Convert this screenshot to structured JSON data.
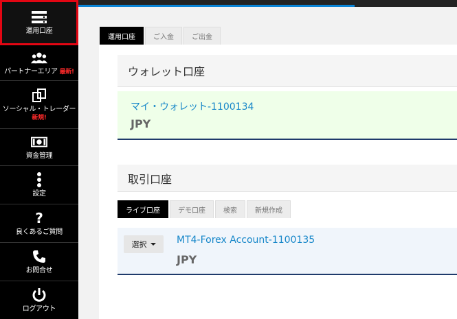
{
  "sidebar": {
    "items": [
      {
        "label": "運用口座",
        "icon": "server-icon",
        "active": true
      },
      {
        "label": "パートナーエリア",
        "badge": "最新!",
        "icon": "users-icon"
      },
      {
        "label": "ソーシャル・トレーダー",
        "badge": "新規!",
        "icon": "copy-icon"
      },
      {
        "label": "資金管理",
        "icon": "money-icon"
      },
      {
        "label": "設定",
        "icon": "dots-vertical-icon"
      },
      {
        "label": "良くあるご質問",
        "icon": "question-icon"
      },
      {
        "label": "お問合せ",
        "icon": "phone-icon"
      },
      {
        "label": "ログアウト",
        "icon": "power-icon"
      }
    ]
  },
  "topbar": {
    "progress_color": "#0a84d6"
  },
  "main_tabs": [
    "運用口座",
    "ご入金",
    "ご出金"
  ],
  "wallet": {
    "title": "ウォレット口座",
    "account_name": "マイ・ウォレット-1100134",
    "currency": "JPY"
  },
  "trading": {
    "title": "取引口座",
    "tabs": [
      "ライブ口座",
      "デモ口座",
      "検索",
      "新規作成"
    ],
    "select_label": "選択",
    "account_name": "MT4-Forex Account-1100135",
    "currency": "JPY"
  },
  "colors": {
    "accent": "#1787c9",
    "active_outline": "#e30613",
    "badge": "#ff2a2a"
  }
}
